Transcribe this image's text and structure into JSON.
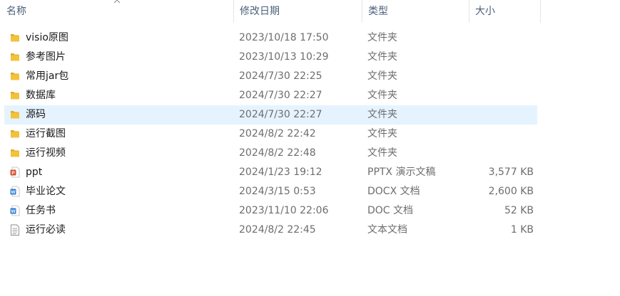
{
  "columns": {
    "name": "名称",
    "date": "修改日期",
    "type": "类型",
    "size": "大小"
  },
  "files": [
    {
      "name": "visio原图",
      "date": "2023/10/18 17:50",
      "type": "文件夹",
      "size": "",
      "icon": "folder-icon"
    },
    {
      "name": "参考图片",
      "date": "2023/10/13 10:29",
      "type": "文件夹",
      "size": "",
      "icon": "folder-icon"
    },
    {
      "name": "常用jar包",
      "date": "2024/7/30 22:25",
      "type": "文件夹",
      "size": "",
      "icon": "folder-icon"
    },
    {
      "name": "数据库",
      "date": "2024/7/30 22:27",
      "type": "文件夹",
      "size": "",
      "icon": "folder-icon"
    },
    {
      "name": "源码",
      "date": "2024/7/30 22:27",
      "type": "文件夹",
      "size": "",
      "icon": "folder-icon",
      "selected": true
    },
    {
      "name": "运行截图",
      "date": "2024/8/2 22:42",
      "type": "文件夹",
      "size": "",
      "icon": "folder-icon"
    },
    {
      "name": "运行视频",
      "date": "2024/8/2 22:48",
      "type": "文件夹",
      "size": "",
      "icon": "folder-icon"
    },
    {
      "name": "ppt",
      "date": "2024/1/23 19:12",
      "type": "PPTX 演示文稿",
      "size": "3,577 KB",
      "icon": "pptx-file-icon"
    },
    {
      "name": "毕业论文",
      "date": "2024/3/15 0:53",
      "type": "DOCX 文档",
      "size": "2,600 KB",
      "icon": "docx-file-icon"
    },
    {
      "name": "任务书",
      "date": "2023/11/10 22:06",
      "type": "DOC 文档",
      "size": "52 KB",
      "icon": "doc-file-icon"
    },
    {
      "name": "运行必读",
      "date": "2024/8/2 22:45",
      "type": "文本文档",
      "size": "1 KB",
      "icon": "text-file-icon"
    }
  ],
  "colors": {
    "folder": "#f3c23b",
    "selected": "#e5f3ff",
    "header_text": "#4c607a",
    "pptx": "#d35230",
    "docx": "#2b7cd3"
  }
}
